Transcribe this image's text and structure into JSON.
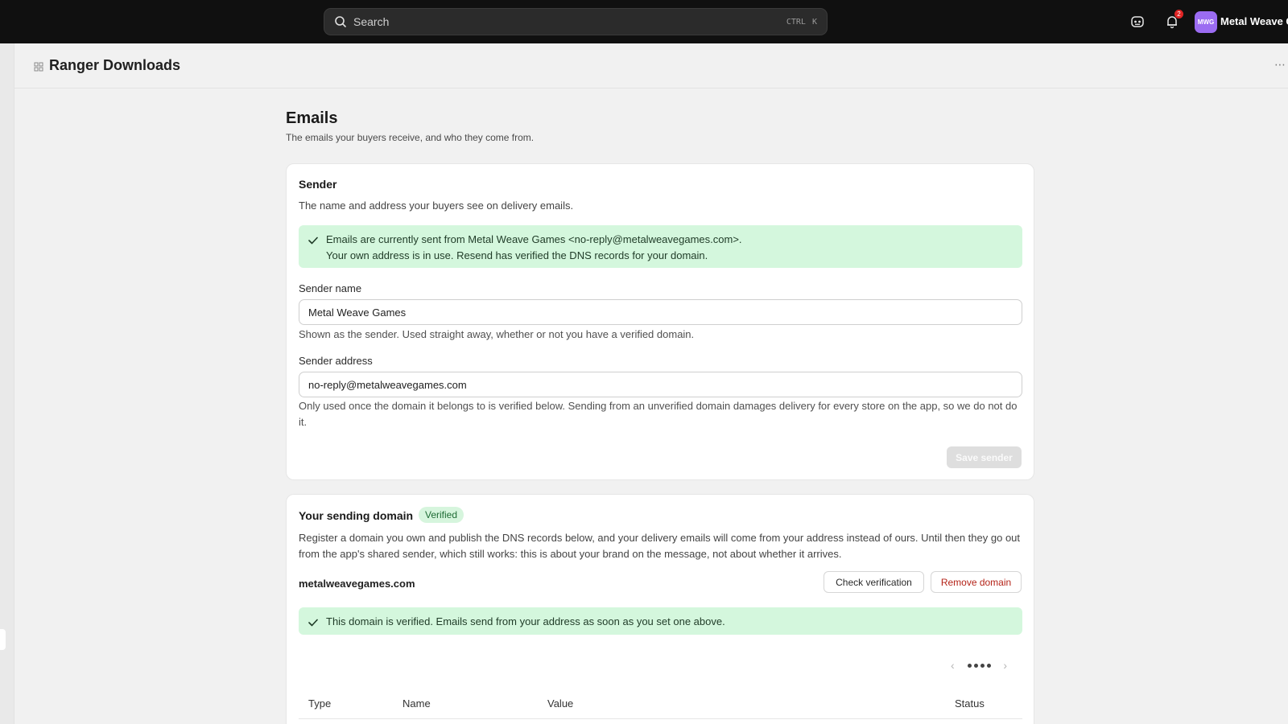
{
  "topbar": {
    "search_placeholder": "Search",
    "shortcut_mod": "CTRL",
    "shortcut_key": "K",
    "notification_count": "2",
    "avatar_initials": "MWG",
    "account_name": "Metal Weave G"
  },
  "page": {
    "store_title": "Ranger Downloads",
    "more_label": "⋯"
  },
  "emails": {
    "title": "Emails",
    "subtitle": "The emails your buyers receive, and who they come from."
  },
  "sender": {
    "title": "Sender",
    "description": "The name and address your buyers see on delivery emails.",
    "notice_line1": "Emails are currently sent from Metal Weave Games <no-reply@metalweavegames.com>.",
    "notice_line2": "Your own address is in use. Resend has verified the DNS records for your domain.",
    "name_label": "Sender name",
    "name_value": "Metal Weave Games",
    "name_help": "Shown as the sender. Used straight away, whether or not you have a verified domain.",
    "address_label": "Sender address",
    "address_value": "no-reply@metalweavegames.com",
    "address_help": "Only used once the domain it belongs to is verified below. Sending from an unverified domain damages delivery for every store on the app, so we do not do it.",
    "save_label": "Save sender"
  },
  "domain": {
    "title": "Your sending domain",
    "badge": "Verified",
    "description": "Register a domain you own and publish the DNS records below, and your delivery emails will come from your address instead of ours. Until then they go out from the app's shared sender, which still works: this is about your brand on the message, not about whether it arrives.",
    "domain_name": "metalweavegames.com",
    "check_label": "Check verification",
    "remove_label": "Remove domain",
    "notice": "This domain is verified. Emails send from your address as soon as you set one above.",
    "table_headers": [
      "Type",
      "Name",
      "Value",
      "Status"
    ]
  },
  "colors": {
    "topbar": "#101010",
    "success_bg": "#d4f7dd",
    "danger": "#b42318",
    "avatar": "#9b6cf2"
  }
}
